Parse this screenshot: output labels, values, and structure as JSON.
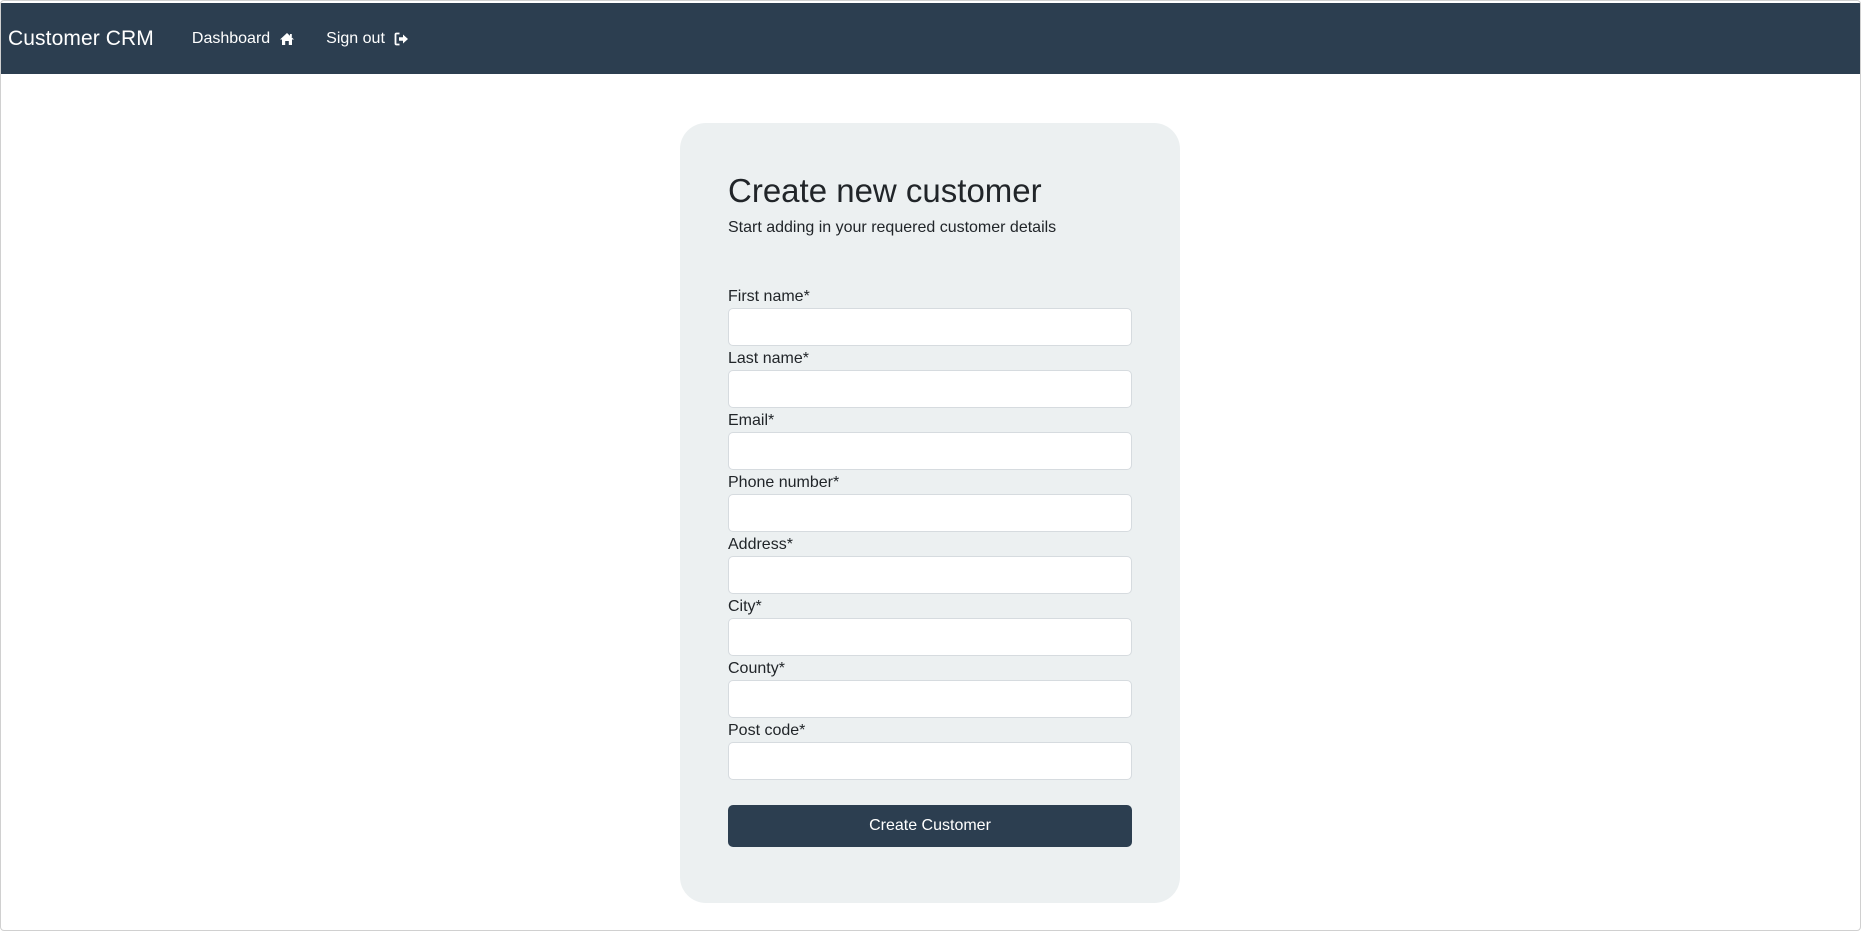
{
  "navbar": {
    "brand": "Customer CRM",
    "links": [
      {
        "label": "Dashboard",
        "icon": "home-icon"
      },
      {
        "label": "Sign out",
        "icon": "sign-out-icon"
      }
    ],
    "background": "#2c3e50"
  },
  "card": {
    "title": "Create new customer",
    "subtitle": "Start adding in your requered customer details",
    "background": "#ecf0f1"
  },
  "form": {
    "fields": [
      {
        "label": "First name*",
        "value": ""
      },
      {
        "label": "Last name*",
        "value": ""
      },
      {
        "label": "Email*",
        "value": ""
      },
      {
        "label": "Phone number*",
        "value": ""
      },
      {
        "label": "Address*",
        "value": ""
      },
      {
        "label": "City*",
        "value": ""
      },
      {
        "label": "County*",
        "value": ""
      },
      {
        "label": "Post code*",
        "value": ""
      }
    ],
    "submit_label": "Create Customer",
    "submit_color": "#2c3e50"
  }
}
